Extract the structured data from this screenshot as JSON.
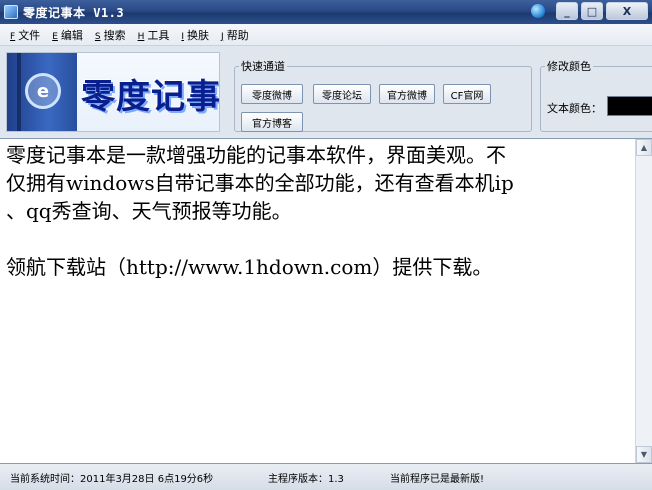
{
  "window": {
    "title": "零度记事本 V1.3",
    "controls": {
      "minimize": "_",
      "maximize": "□",
      "close": "X"
    }
  },
  "menu": [
    {
      "key": "F",
      "label": "文件"
    },
    {
      "key": "E",
      "label": "编辑"
    },
    {
      "key": "S",
      "label": "搜索"
    },
    {
      "key": "H",
      "label": "工具"
    },
    {
      "key": "I",
      "label": "换肤"
    },
    {
      "key": "J",
      "label": "帮助"
    }
  ],
  "logo": {
    "text": "零度记事本",
    "emblem_glyph": "e"
  },
  "quick_access": {
    "legend": "快速通道",
    "buttons": [
      "零度微博",
      "零度论坛",
      "官方微博",
      "CF官网",
      "官方博客"
    ]
  },
  "color_settings": {
    "legend": "修改颜色",
    "text_color_label": "文本颜色：",
    "text_color_value": "#000000"
  },
  "editor": {
    "lines": [
      "零度记事本是一款增强功能的记事本软件，界面美观。不",
      "仅拥有windows自带记事本的全部功能，还有查看本机ip",
      "、qq秀查询、天气预报等功能。",
      "",
      "领航下载站（http://www.1hdown.com）提供下载。"
    ]
  },
  "status": {
    "system_time": "当前系统时间：2011年3月28日 6点19分6秒",
    "version": "主程序版本：1.3",
    "update": "当前程序已是最新版!"
  },
  "colors": {
    "titlebar": "#294a86",
    "logo_text": "#0a1f8e",
    "background": "#dfe6ee"
  }
}
